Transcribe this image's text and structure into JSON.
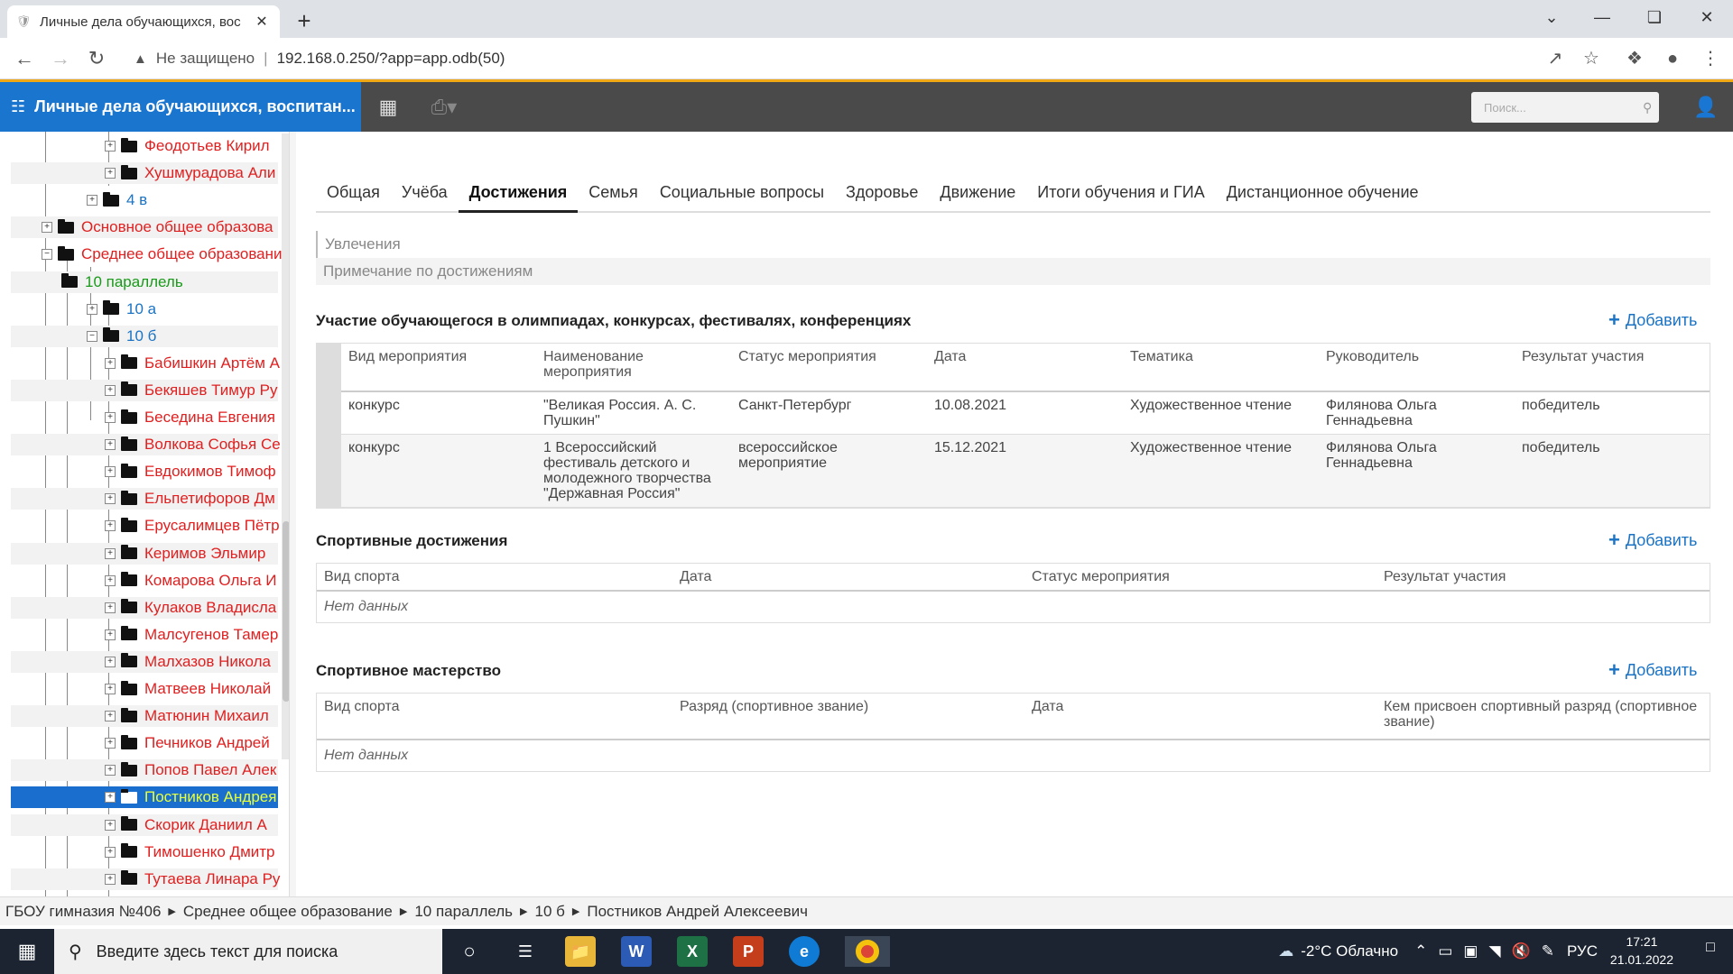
{
  "browser": {
    "tab_title": "Личные дела обучающихся, вос",
    "address_security": "Не защищено",
    "url": "192.168.0.250/?app=app.odb(50)"
  },
  "app": {
    "title": "Личные дела обучающихся, воспитан...",
    "search_placeholder": "Поиск..."
  },
  "tree": [
    {
      "label": "Феодотьев Кирил",
      "color": "#e02020"
    },
    {
      "label": "Хушмурадова Али",
      "color": "#e02020"
    },
    {
      "label": "4 в",
      "color": "#1a73c4"
    },
    {
      "label": "Основное общее образова",
      "color": "#e02020"
    },
    {
      "label": "Среднее общее образовани",
      "color": "#e02020"
    },
    {
      "label": "10 параллель",
      "color": "#1a9a1a"
    },
    {
      "label": "10 а",
      "color": "#1a73c4"
    },
    {
      "label": "10 б",
      "color": "#1a73c4"
    },
    {
      "label": "Бабишкин Артём А",
      "color": "#e02020"
    },
    {
      "label": "Бекяшев Тимур Ру",
      "color": "#e02020"
    },
    {
      "label": "Беседина Евгения",
      "color": "#e02020"
    },
    {
      "label": "Волкова Софья Се",
      "color": "#e02020"
    },
    {
      "label": "Евдокимов Тимоф",
      "color": "#e02020"
    },
    {
      "label": "Ельпетифоров Дм",
      "color": "#e02020"
    },
    {
      "label": "Ерусалимцев Пётр",
      "color": "#e02020"
    },
    {
      "label": "Керимов Эльмир",
      "color": "#e02020"
    },
    {
      "label": "Комарова Ольга И",
      "color": "#e02020"
    },
    {
      "label": "Кулаков Владисла",
      "color": "#e02020"
    },
    {
      "label": "Малсугенов Тамер",
      "color": "#e02020"
    },
    {
      "label": "Малхазов Никола",
      "color": "#e02020"
    },
    {
      "label": "Матвеев Николай",
      "color": "#e02020"
    },
    {
      "label": "Матюнин Михаил",
      "color": "#e02020"
    },
    {
      "label": "Печников Андрей",
      "color": "#e02020"
    },
    {
      "label": "Попов Павел Алек",
      "color": "#e02020"
    },
    {
      "label": "Постников Андрея",
      "color": "#e8ff3a"
    },
    {
      "label": "Скорик Даниил А",
      "color": "#e02020"
    },
    {
      "label": "Тимошенко Дмитр",
      "color": "#e02020"
    },
    {
      "label": "Тутаева Линара Ру",
      "color": "#e02020"
    }
  ],
  "tabs": [
    "Общая",
    "Учёба",
    "Достижения",
    "Семья",
    "Социальные вопросы",
    "Здоровье",
    "Движение",
    "Итоги обучения и ГИА",
    "Дистанционное обучение"
  ],
  "active_tab": "Достижения",
  "fields": {
    "hobbies": "Увлечения",
    "achievements_note": "Примечание по достижениям"
  },
  "add_label": "Добавить",
  "olympiads": {
    "title": "Участие обучающегося в олимпиадах, конкурсах, фестивалях, конференциях",
    "columns": [
      "Вид мероприятия",
      "Наименование мероприятия",
      "Статус мероприятия",
      "Дата",
      "Тематика",
      "Руководитель",
      "Результат участия"
    ],
    "rows": [
      [
        "конкурс",
        "\"Великая Россия. А. С. Пушкин\"",
        "Санкт-Петербург",
        "10.08.2021",
        "Художественное чтение",
        "Филянова Ольга Геннадьевна",
        "победитель"
      ],
      [
        "конкурс",
        "1 Всероссийский фестиваль детского и молодежного творчества \"Державная Россия\"",
        "всероссийское мероприятие",
        "15.12.2021",
        "Художественное чтение",
        "Филянова Ольга Геннадьевна",
        "победитель"
      ]
    ]
  },
  "sports": {
    "title": "Спортивные достижения",
    "columns": [
      "Вид спорта",
      "Дата",
      "Статус мероприятия",
      "Результат участия"
    ],
    "empty": "Нет данных"
  },
  "mastery": {
    "title": "Спортивное мастерство",
    "columns": [
      "Вид спорта",
      "Разряд (спортивное звание)",
      "Дата",
      "Кем присвоен спортивный разряд (спортивное звание)"
    ],
    "empty": "Нет данных"
  },
  "breadcrumb": [
    "ГБОУ гимназия №406",
    "Среднее общее образование",
    "10 параллель",
    "10 б",
    "Постников Андрей Алексеевич"
  ],
  "taskbar": {
    "search_placeholder": "Введите здесь текст для поиска",
    "weather": "-2°C  Облачно",
    "lang": "РУС",
    "time": "17:21",
    "date": "21.01.2022"
  }
}
